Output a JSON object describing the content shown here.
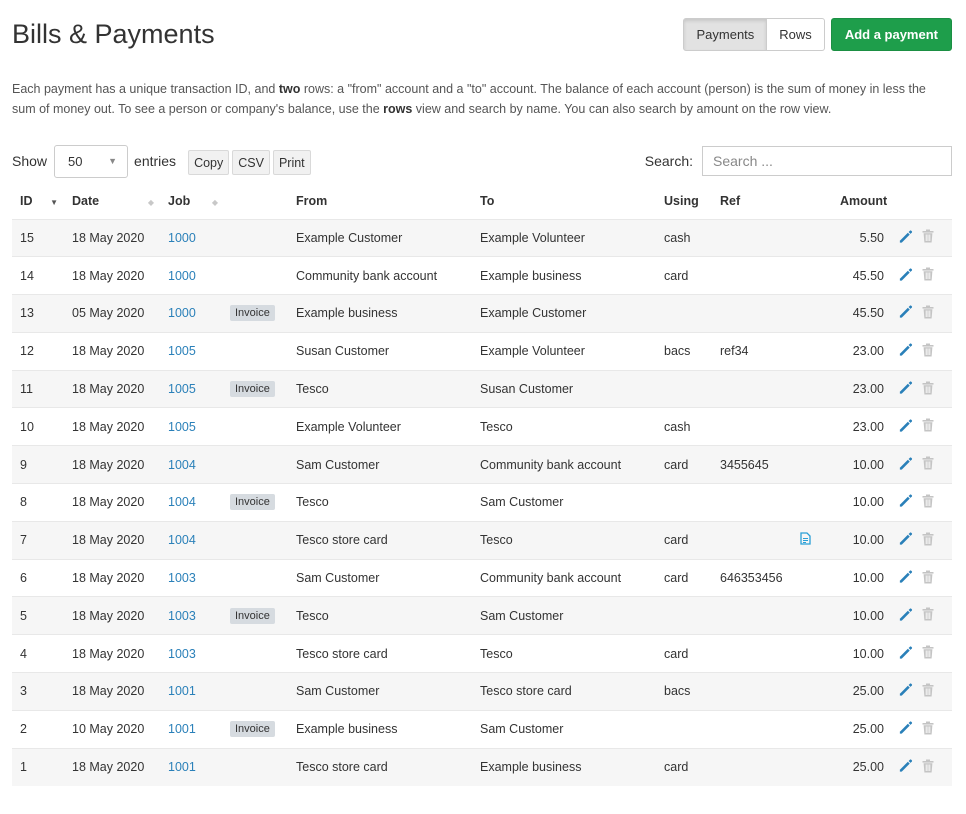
{
  "page": {
    "title": "Bills & Payments",
    "view_buttons": [
      "Payments",
      "Rows"
    ],
    "add_button": "Add a payment",
    "intro": {
      "p1": "Each payment has a unique transaction ID, and ",
      "b1": "two",
      "p2": " rows: a \"from\" account and a \"to\" account. The balance of each account (person) is the sum of money in less the sum of money out. To see a person or company's balance, use the ",
      "b2": "rows",
      "p3": " view and search by name. You can also search by amount on the row view."
    }
  },
  "controls": {
    "show_label": "Show",
    "length_value": "50",
    "entries_label": "entries",
    "export": [
      "Copy",
      "CSV",
      "Print"
    ],
    "search_label": "Search:",
    "search_placeholder": "Search ..."
  },
  "table": {
    "headers": [
      "ID",
      "Date",
      "Job",
      "",
      "From",
      "To",
      "Using",
      "Ref",
      "",
      "Amount"
    ],
    "rows": [
      {
        "id": "15",
        "date": "18 May 2020",
        "job": "1000",
        "badge": "",
        "from": "Example Customer",
        "to": "Example Volunteer",
        "using": "cash",
        "ref": "",
        "doc": false,
        "amount": "5.50"
      },
      {
        "id": "14",
        "date": "18 May 2020",
        "job": "1000",
        "badge": "",
        "from": "Community bank account",
        "to": "Example business",
        "using": "card",
        "ref": "",
        "doc": false,
        "amount": "45.50"
      },
      {
        "id": "13",
        "date": "05 May 2020",
        "job": "1000",
        "badge": "Invoice",
        "from": "Example business",
        "to": "Example Customer",
        "using": "",
        "ref": "",
        "doc": false,
        "amount": "45.50"
      },
      {
        "id": "12",
        "date": "18 May 2020",
        "job": "1005",
        "badge": "",
        "from": "Susan Customer",
        "to": "Example Volunteer",
        "using": "bacs",
        "ref": "ref34",
        "doc": false,
        "amount": "23.00"
      },
      {
        "id": "11",
        "date": "18 May 2020",
        "job": "1005",
        "badge": "Invoice",
        "from": "Tesco",
        "to": "Susan Customer",
        "using": "",
        "ref": "",
        "doc": false,
        "amount": "23.00"
      },
      {
        "id": "10",
        "date": "18 May 2020",
        "job": "1005",
        "badge": "",
        "from": "Example Volunteer",
        "to": "Tesco",
        "using": "cash",
        "ref": "",
        "doc": false,
        "amount": "23.00"
      },
      {
        "id": "9",
        "date": "18 May 2020",
        "job": "1004",
        "badge": "",
        "from": "Sam Customer",
        "to": "Community bank account",
        "using": "card",
        "ref": "3455645",
        "doc": false,
        "amount": "10.00"
      },
      {
        "id": "8",
        "date": "18 May 2020",
        "job": "1004",
        "badge": "Invoice",
        "from": "Tesco",
        "to": "Sam Customer",
        "using": "",
        "ref": "",
        "doc": false,
        "amount": "10.00"
      },
      {
        "id": "7",
        "date": "18 May 2020",
        "job": "1004",
        "badge": "",
        "from": "Tesco store card",
        "to": "Tesco",
        "using": "card",
        "ref": "",
        "doc": true,
        "amount": "10.00"
      },
      {
        "id": "6",
        "date": "18 May 2020",
        "job": "1003",
        "badge": "",
        "from": "Sam Customer",
        "to": "Community bank account",
        "using": "card",
        "ref": "646353456",
        "doc": false,
        "amount": "10.00"
      },
      {
        "id": "5",
        "date": "18 May 2020",
        "job": "1003",
        "badge": "Invoice",
        "from": "Tesco",
        "to": "Sam Customer",
        "using": "",
        "ref": "",
        "doc": false,
        "amount": "10.00"
      },
      {
        "id": "4",
        "date": "18 May 2020",
        "job": "1003",
        "badge": "",
        "from": "Tesco store card",
        "to": "Tesco",
        "using": "card",
        "ref": "",
        "doc": false,
        "amount": "10.00"
      },
      {
        "id": "3",
        "date": "18 May 2020",
        "job": "1001",
        "badge": "",
        "from": "Sam Customer",
        "to": "Tesco store card",
        "using": "bacs",
        "ref": "",
        "doc": false,
        "amount": "25.00"
      },
      {
        "id": "2",
        "date": "10 May 2020",
        "job": "1001",
        "badge": "Invoice",
        "from": "Example business",
        "to": "Sam Customer",
        "using": "",
        "ref": "",
        "doc": false,
        "amount": "25.00"
      },
      {
        "id": "1",
        "date": "18 May 2020",
        "job": "1001",
        "badge": "",
        "from": "Tesco store card",
        "to": "Example business",
        "using": "card",
        "ref": "",
        "doc": false,
        "amount": "25.00"
      }
    ]
  },
  "icons": {
    "edit": "pencil-icon",
    "delete": "trash-icon",
    "document": "document-icon",
    "sort": "sort-icon"
  },
  "colors": {
    "accent_link": "#2a80b9",
    "success": "#1e9e4b",
    "edit_icon": "#2a80b9",
    "trash_icon": "#c4c4c4",
    "doc_icon": "#2a9fd6"
  }
}
